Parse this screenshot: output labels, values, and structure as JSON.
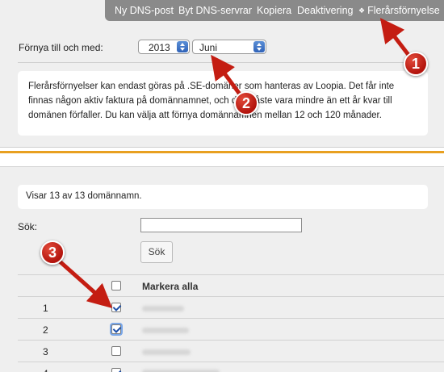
{
  "nav": {
    "tabs": [
      "Ny DNS-post",
      "Byt DNS-servrar",
      "Kopiera",
      "Deaktivering",
      "Flerårsförnyelse"
    ],
    "active_marker": "❖"
  },
  "renew": {
    "label": "Förnya till och med:",
    "year": "2013",
    "month": "Juni",
    "info": "Flerårsförnyelser kan endast göras på .SE-domäner som hanteras av Loopia. Det får inte finnas någon aktiv faktura på domännamnet, och det måste vara mindre än ett år kvar till domänen förfaller. Du kan välja att förnya domännamnen mellan 12 och 120 månader."
  },
  "list": {
    "count_text": "Visar 13 av 13 domännamn.",
    "search_label": "Sök:",
    "search_value": "",
    "search_button": "Sök",
    "mark_all": "Markera alla",
    "rows": [
      {
        "num": "1",
        "checked": true
      },
      {
        "num": "2",
        "checked": true
      },
      {
        "num": "3",
        "checked": false
      },
      {
        "num": "4",
        "checked": true
      }
    ]
  },
  "callouts": [
    "1",
    "2",
    "3"
  ],
  "colors": {
    "tab_bar": "#8a8a8a",
    "accent_line": "#e8a020",
    "callout": "#c41d12"
  }
}
